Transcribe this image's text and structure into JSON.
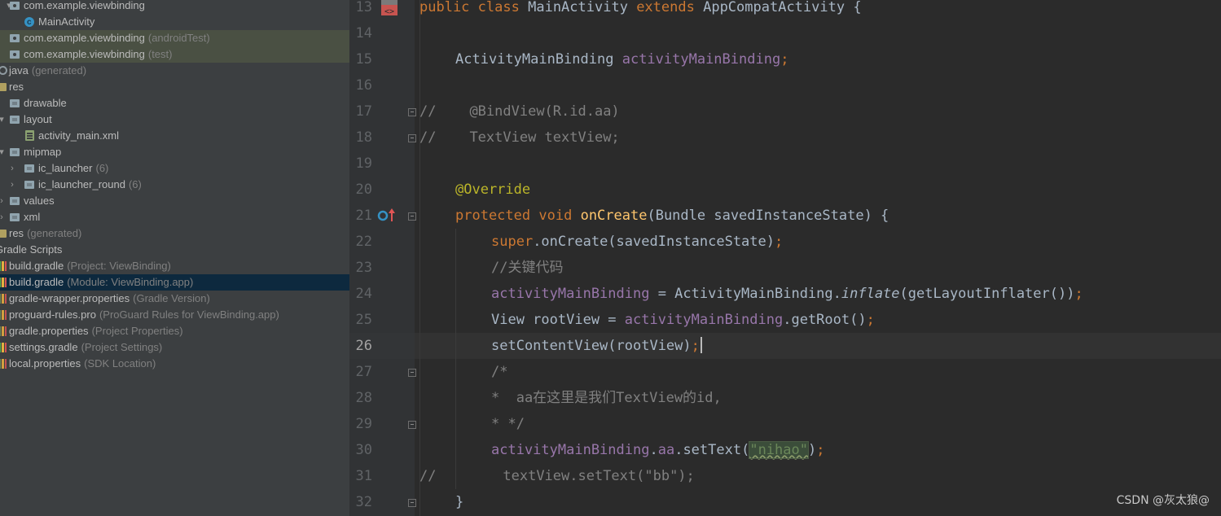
{
  "tree": {
    "items": [
      {
        "label": "com.example.viewbinding",
        "hint": "",
        "icon": "package-icon"
      },
      {
        "label": "MainActivity",
        "hint": "",
        "icon": "class-icon"
      },
      {
        "label": "com.example.viewbinding",
        "hint": "(androidTest)",
        "icon": "package-icon"
      },
      {
        "label": "com.example.viewbinding",
        "hint": "(test)",
        "icon": "package-icon"
      },
      {
        "label": "java",
        "hint": "(generated)",
        "icon": "gear-folder-icon"
      },
      {
        "label": "res",
        "hint": "",
        "icon": "res-folder-icon"
      },
      {
        "label": "drawable",
        "hint": "",
        "icon": "folder-icon"
      },
      {
        "label": "layout",
        "hint": "",
        "icon": "folder-icon"
      },
      {
        "label": "activity_main.xml",
        "hint": "",
        "icon": "xml-file-icon"
      },
      {
        "label": "mipmap",
        "hint": "",
        "icon": "folder-icon"
      },
      {
        "label": "ic_launcher",
        "hint": "(6)",
        "icon": "folder-icon"
      },
      {
        "label": "ic_launcher_round",
        "hint": "(6)",
        "icon": "folder-icon"
      },
      {
        "label": "values",
        "hint": "",
        "icon": "folder-icon"
      },
      {
        "label": "xml",
        "hint": "",
        "icon": "folder-icon"
      },
      {
        "label": "res",
        "hint": "(generated)",
        "icon": "res-folder-icon"
      },
      {
        "label": "Gradle Scripts",
        "hint": "",
        "icon": "gradle-icon"
      },
      {
        "label": "build.gradle",
        "hint": "(Project: ViewBinding)",
        "icon": "gradle-icon"
      },
      {
        "label": "build.gradle",
        "hint": "(Module: ViewBinding.app)",
        "icon": "gradle-icon"
      },
      {
        "label": "gradle-wrapper.properties",
        "hint": "(Gradle Version)",
        "icon": "properties-icon"
      },
      {
        "label": "proguard-rules.pro",
        "hint": "(ProGuard Rules for ViewBinding.app)",
        "icon": "properties-icon"
      },
      {
        "label": "gradle.properties",
        "hint": "(Project Properties)",
        "icon": "properties-icon"
      },
      {
        "label": "settings.gradle",
        "hint": "(Project Settings)",
        "icon": "gradle-icon"
      },
      {
        "label": "local.properties",
        "hint": "(SDK Location)",
        "icon": "properties-icon"
      }
    ]
  },
  "editor": {
    "line_numbers": [
      "13",
      "14",
      "15",
      "16",
      "17",
      "18",
      "19",
      "20",
      "21",
      "22",
      "23",
      "24",
      "25",
      "26",
      "27",
      "28",
      "29",
      "30",
      "31",
      "32"
    ],
    "current_line": "26",
    "tokens": {
      "l13": {
        "a": "public",
        "b": "class",
        "c": "MainActivity",
        "d": "extends",
        "e": "AppCompatActivity",
        "f": "{"
      },
      "l15": {
        "a": "ActivityMainBinding",
        "b": "activityMainBinding",
        "c": ";"
      },
      "l17": {
        "a": "//",
        "b": "@BindView(R.id.aa)"
      },
      "l18": {
        "a": "//",
        "b": "TextView textView;"
      },
      "l20": {
        "a": "@Override"
      },
      "l21": {
        "a": "protected",
        "b": "void",
        "c": "onCreate",
        "d": "(Bundle savedInstanceState) {"
      },
      "l22": {
        "a": "super",
        "b": ".onCreate(savedInstanceState)",
        "c": ";"
      },
      "l23": {
        "a": "//关键代码"
      },
      "l24": {
        "a": "activityMainBinding",
        "b": " = ActivityMainBinding.",
        "c": "inflate",
        "d": "(getLayoutInflater())",
        "e": ";"
      },
      "l25": {
        "a": "View rootView = ",
        "b": "activityMainBinding",
        "c": ".getRoot()",
        "d": ";"
      },
      "l26": {
        "a": "setContentView(rootView)",
        "b": ";"
      },
      "l27": {
        "a": "/*"
      },
      "l28": {
        "a": "*  aa在这里是我们TextView的id,"
      },
      "l29": {
        "a": "* */"
      },
      "l30": {
        "a": "activityMainBinding",
        "b": ".",
        "c": "aa",
        "d": ".setText(",
        "e": "\"nihao\"",
        "f": ")",
        "g": ";"
      },
      "l31": {
        "a": "//",
        "b": "textView.setText(\"bb\");"
      },
      "l32": {
        "a": "}"
      }
    }
  },
  "watermark": "CSDN @灰太狼@",
  "colors": {
    "keyword": "#cc7832",
    "field": "#9876aa",
    "method": "#ffc66d",
    "annotation": "#bbb529",
    "comment": "#808080",
    "string": "#6a8759",
    "text": "#a9b7c6",
    "editor_bg": "#2b2b2b",
    "tree_bg": "#3c3f41",
    "tree_selected": "#0d293e"
  }
}
